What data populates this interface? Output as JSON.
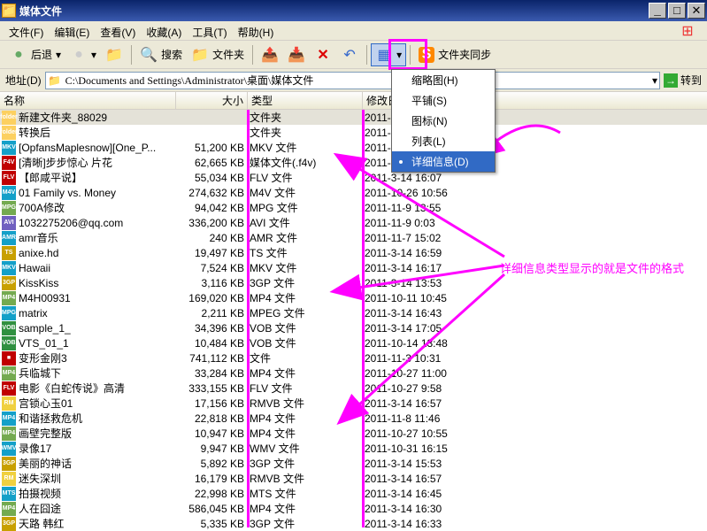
{
  "window": {
    "title": "媒体文件"
  },
  "menu": {
    "file": "文件(F)",
    "edit": "编辑(E)",
    "view": "查看(V)",
    "favorites": "收藏(A)",
    "tools": "工具(T)",
    "help": "帮助(H)"
  },
  "toolbar": {
    "back": "后退",
    "search": "搜索",
    "folders": "文件夹",
    "folder_sync": "文件夹同步"
  },
  "address": {
    "label": "地址(D)",
    "path": "C:\\Documents and Settings\\Administrator\\桌面\\媒体文件",
    "go": "转到"
  },
  "headers": {
    "name": "名称",
    "size": "大小",
    "type": "类型",
    "date": "修改日"
  },
  "views_menu": {
    "thumbnails": "缩略图(H)",
    "tiles": "平铺(S)",
    "icons": "图标(N)",
    "list": "列表(L)",
    "details": "详细信息(D)"
  },
  "annotation": "详细信息类型显示的就是文件的格式",
  "files": [
    {
      "icon": "folder",
      "c": "#fcd060",
      "name": "新建文件夹_88029",
      "size": "",
      "type": "文件夹",
      "date": "2011-",
      "sel": true
    },
    {
      "icon": "folder",
      "c": "#fcd060",
      "name": "转换后",
      "size": "",
      "type": "文件夹",
      "date": "2011-"
    },
    {
      "icon": "MKV",
      "c": "#14a0c8",
      "name": "[OpfansMaplesnow][One_P...",
      "size": "51,200 KB",
      "type": "MKV 文件",
      "date": "2011-3-14 16:07"
    },
    {
      "icon": "F4V",
      "c": "#c00000",
      "name": "[清晰]步步惊心 片花",
      "size": "62,665 KB",
      "type": "媒体文件(.f4v)",
      "date": "2011-3-14 16:07"
    },
    {
      "icon": "FLV",
      "c": "#c00000",
      "name": "【郎咸平说】",
      "size": "55,034 KB",
      "type": "FLV 文件",
      "date": "2011-3-14 16:07"
    },
    {
      "icon": "M4V",
      "c": "#14a0c8",
      "name": "01 Family vs. Money",
      "size": "274,632 KB",
      "type": "M4V 文件",
      "date": "2011-10-26 10:56"
    },
    {
      "icon": "MPG",
      "c": "#74aa50",
      "name": "700A修改",
      "size": "94,042 KB",
      "type": "MPG 文件",
      "date": "2011-11-9 13:55"
    },
    {
      "icon": "AVI",
      "c": "#7060c0",
      "name": "1032275206@qq.com",
      "size": "336,200 KB",
      "type": "AVI 文件",
      "date": "2011-11-9 0:03"
    },
    {
      "icon": "AMR",
      "c": "#14a0c8",
      "name": "amr音乐",
      "size": "240 KB",
      "type": "AMR 文件",
      "date": "2011-11-7 15:02"
    },
    {
      "icon": "TS",
      "c": "#c8a000",
      "name": "anixe.hd",
      "size": "19,497 KB",
      "type": "TS 文件",
      "date": "2011-3-14 16:59"
    },
    {
      "icon": "MKV",
      "c": "#14a0c8",
      "name": "Hawaii",
      "size": "7,524 KB",
      "type": "MKV 文件",
      "date": "2011-3-14 16:17"
    },
    {
      "icon": "3GP",
      "c": "#c8a000",
      "name": "KissKiss",
      "size": "3,116 KB",
      "type": "3GP 文件",
      "date": "2011-3-14 13:53"
    },
    {
      "icon": "MP4",
      "c": "#74aa50",
      "name": "M4H00931",
      "size": "169,020 KB",
      "type": "MP4 文件",
      "date": "2011-10-11 10:45"
    },
    {
      "icon": "MPG",
      "c": "#14a0c8",
      "name": "matrix",
      "size": "2,211 KB",
      "type": "MPEG 文件",
      "date": "2011-3-14 16:43"
    },
    {
      "icon": "VOB",
      "c": "#309040",
      "name": "sample_1_",
      "size": "34,396 KB",
      "type": "VOB 文件",
      "date": "2011-3-14 17:05"
    },
    {
      "icon": "VOB",
      "c": "#309040",
      "name": "VTS_01_1",
      "size": "10,484 KB",
      "type": "VOB 文件",
      "date": "2011-10-14 13:48"
    },
    {
      "icon": "",
      "c": "#c00000",
      "name": "变形金刚3",
      "size": "741,112 KB",
      "type": "文件",
      "date": "2011-11-3 10:31"
    },
    {
      "icon": "MP4",
      "c": "#74aa50",
      "name": "兵临城下",
      "size": "33,284 KB",
      "type": "MP4 文件",
      "date": "2011-10-27 11:00"
    },
    {
      "icon": "FLV",
      "c": "#c00000",
      "name": "电影《白蛇传说》高清",
      "size": "333,155 KB",
      "type": "FLV 文件",
      "date": "2011-10-27 9:58"
    },
    {
      "icon": "RM",
      "c": "#f0d040",
      "name": "宫锁心玉01",
      "size": "17,156 KB",
      "type": "RMVB 文件",
      "date": "2011-3-14 16:57"
    },
    {
      "icon": "MP4",
      "c": "#14a0c8",
      "name": "和谐拯救危机",
      "size": "22,818 KB",
      "type": "MP4 文件",
      "date": "2011-11-8 11:46"
    },
    {
      "icon": "MP4",
      "c": "#74aa50",
      "name": "画壁完整版",
      "size": "10,947 KB",
      "type": "MP4 文件",
      "date": "2011-10-27 10:55"
    },
    {
      "icon": "WMV",
      "c": "#14a0c8",
      "name": "录像17",
      "size": "9,947 KB",
      "type": "WMV 文件",
      "date": "2011-10-31 16:15"
    },
    {
      "icon": "3GP",
      "c": "#c8a000",
      "name": "美丽的神话",
      "size": "5,892 KB",
      "type": "3GP 文件",
      "date": "2011-3-14 15:53"
    },
    {
      "icon": "RM",
      "c": "#f0d040",
      "name": "迷失深圳",
      "size": "16,179 KB",
      "type": "RMVB 文件",
      "date": "2011-3-14 16:57"
    },
    {
      "icon": "MTS",
      "c": "#14a0c8",
      "name": "拍摄视频",
      "size": "22,998 KB",
      "type": "MTS 文件",
      "date": "2011-3-14 16:45"
    },
    {
      "icon": "MP4",
      "c": "#74aa50",
      "name": "人在囧途",
      "size": "586,045 KB",
      "type": "MP4 文件",
      "date": "2011-3-14 16:30"
    },
    {
      "icon": "3GP",
      "c": "#c8a000",
      "name": "天路 韩红",
      "size": "5,335 KB",
      "type": "3GP 文件",
      "date": "2011-3-14 16:33"
    }
  ]
}
